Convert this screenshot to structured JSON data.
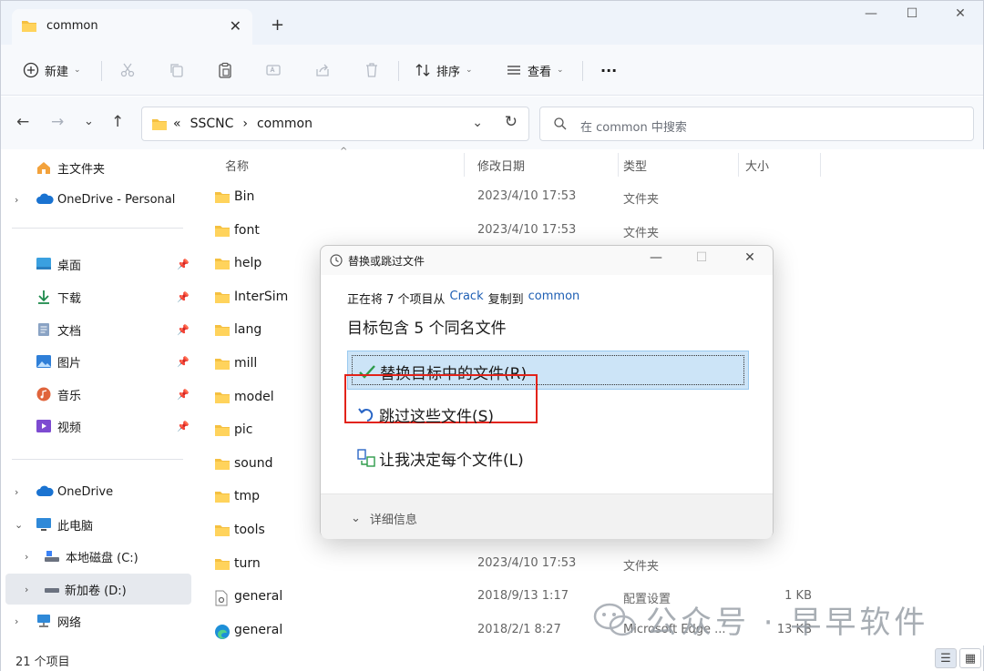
{
  "window": {
    "tab_title": "common",
    "tab_close": "✕",
    "new_tab": "+",
    "minimize": "—",
    "maximize": "☐",
    "close": "✕"
  },
  "toolbar": {
    "new_label": "新建",
    "sort_label": "排序",
    "view_label": "查看",
    "more_label": "···"
  },
  "address": {
    "overflow": "«",
    "crumbs": [
      "SSCNC",
      "›",
      "common"
    ],
    "search_placeholder": "在 common 中搜索"
  },
  "sidebar": {
    "home": "主文件夹",
    "onedrive_personal": "OneDrive - Personal",
    "quick": [
      {
        "label": "桌面"
      },
      {
        "label": "下载"
      },
      {
        "label": "文档"
      },
      {
        "label": "图片"
      },
      {
        "label": "音乐"
      },
      {
        "label": "视频"
      }
    ],
    "onedrive": "OneDrive",
    "this_pc": "此电脑",
    "drive_c": "本地磁盘 (C:)",
    "drive_d": "新加卷 (D:)",
    "network": "网络"
  },
  "columns": {
    "name": "名称",
    "date": "修改日期",
    "type": "类型",
    "size": "大小"
  },
  "files": [
    {
      "name": "Bin",
      "date": "2023/4/10 17:53",
      "type": "文件夹",
      "size": "",
      "kind": "folder"
    },
    {
      "name": "font",
      "date": "2023/4/10 17:53",
      "type": "文件夹",
      "size": "",
      "kind": "folder"
    },
    {
      "name": "help",
      "date": "",
      "type": "",
      "size": "",
      "kind": "folder"
    },
    {
      "name": "InterSim",
      "date": "",
      "type": "",
      "size": "",
      "kind": "folder"
    },
    {
      "name": "lang",
      "date": "",
      "type": "",
      "size": "",
      "kind": "folder"
    },
    {
      "name": "mill",
      "date": "",
      "type": "",
      "size": "",
      "kind": "folder"
    },
    {
      "name": "model",
      "date": "",
      "type": "",
      "size": "",
      "kind": "folder"
    },
    {
      "name": "pic",
      "date": "",
      "type": "",
      "size": "",
      "kind": "folder"
    },
    {
      "name": "sound",
      "date": "",
      "type": "",
      "size": "",
      "kind": "folder"
    },
    {
      "name": "tmp",
      "date": "",
      "type": "",
      "size": "",
      "kind": "folder"
    },
    {
      "name": "tools",
      "date": "",
      "type": "",
      "size": "",
      "kind": "folder"
    },
    {
      "name": "turn",
      "date": "2023/4/10 17:53",
      "type": "文件夹",
      "size": "",
      "kind": "folder"
    },
    {
      "name": "general",
      "date": "2018/9/13 1:17",
      "type": "配置设置",
      "size": "1 KB",
      "kind": "config"
    },
    {
      "name": "general",
      "date": "2018/2/1 8:27",
      "type": "Microsoft Edge ...",
      "size": "13 KB",
      "kind": "edge"
    }
  ],
  "status": {
    "count": "21 个项目"
  },
  "dialog": {
    "title": "替换或跳过文件",
    "line1_prefix": "正在将 7 个项目从",
    "source": "Crack",
    "line1_mid": "复制到",
    "dest": "common",
    "line2": "目标包含 5 个同名文件",
    "replace": "替换目标中的文件(R)",
    "skip": "跳过这些文件(S)",
    "decide": "让我决定每个文件(L)",
    "details": "详细信息"
  },
  "watermark": {
    "text": "公众号 · 早早软件"
  },
  "colors": {
    "accent": "#1e5fb4",
    "folder": "#f5c040",
    "highlight": "#cce4f7",
    "annotation": "#e2231a"
  }
}
